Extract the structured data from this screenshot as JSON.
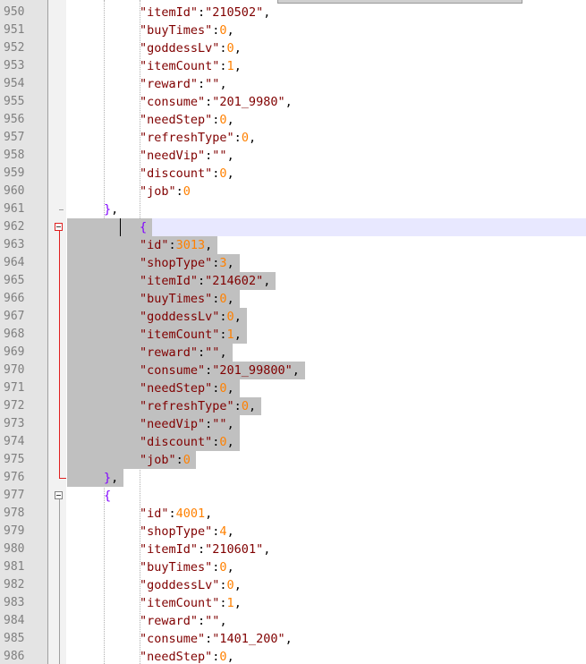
{
  "lines": [
    {
      "n": "950",
      "indent": 2,
      "t": [
        [
          "k",
          "\"itemId\""
        ],
        [
          "p",
          ":"
        ],
        [
          "s",
          "\"210502\""
        ],
        [
          "p",
          ","
        ]
      ]
    },
    {
      "n": "951",
      "indent": 2,
      "t": [
        [
          "k",
          "\"buyTimes\""
        ],
        [
          "p",
          ":"
        ],
        [
          "n",
          "0"
        ],
        [
          "p",
          ","
        ]
      ]
    },
    {
      "n": "952",
      "indent": 2,
      "t": [
        [
          "k",
          "\"goddessLv\""
        ],
        [
          "p",
          ":"
        ],
        [
          "n",
          "0"
        ],
        [
          "p",
          ","
        ]
      ]
    },
    {
      "n": "953",
      "indent": 2,
      "t": [
        [
          "k",
          "\"itemCount\""
        ],
        [
          "p",
          ":"
        ],
        [
          "n",
          "1"
        ],
        [
          "p",
          ","
        ]
      ]
    },
    {
      "n": "954",
      "indent": 2,
      "t": [
        [
          "k",
          "\"reward\""
        ],
        [
          "p",
          ":"
        ],
        [
          "s",
          "\"\""
        ],
        [
          "p",
          ","
        ]
      ]
    },
    {
      "n": "955",
      "indent": 2,
      "t": [
        [
          "k",
          "\"consume\""
        ],
        [
          "p",
          ":"
        ],
        [
          "s",
          "\"201_9980\""
        ],
        [
          "p",
          ","
        ]
      ]
    },
    {
      "n": "956",
      "indent": 2,
      "t": [
        [
          "k",
          "\"needStep\""
        ],
        [
          "p",
          ":"
        ],
        [
          "n",
          "0"
        ],
        [
          "p",
          ","
        ]
      ]
    },
    {
      "n": "957",
      "indent": 2,
      "t": [
        [
          "k",
          "\"refreshType\""
        ],
        [
          "p",
          ":"
        ],
        [
          "n",
          "0"
        ],
        [
          "p",
          ","
        ]
      ]
    },
    {
      "n": "958",
      "indent": 2,
      "t": [
        [
          "k",
          "\"needVip\""
        ],
        [
          "p",
          ":"
        ],
        [
          "s",
          "\"\""
        ],
        [
          "p",
          ","
        ]
      ]
    },
    {
      "n": "959",
      "indent": 2,
      "t": [
        [
          "k",
          "\"discount\""
        ],
        [
          "p",
          ":"
        ],
        [
          "n",
          "0"
        ],
        [
          "p",
          ","
        ]
      ]
    },
    {
      "n": "960",
      "indent": 2,
      "t": [
        [
          "k",
          "\"job\""
        ],
        [
          "p",
          ":"
        ],
        [
          "n",
          "0"
        ]
      ]
    },
    {
      "n": "961",
      "indent": 1,
      "t": [
        [
          "b",
          "}"
        ],
        [
          "p",
          ","
        ]
      ]
    },
    {
      "n": "962",
      "indent": 2,
      "t": [
        [
          "b",
          "{"
        ]
      ],
      "current": true,
      "sel": true
    },
    {
      "n": "963",
      "indent": 2,
      "t": [
        [
          "k",
          "\"id\""
        ],
        [
          "p",
          ":"
        ],
        [
          "n",
          "3013"
        ],
        [
          "p",
          ","
        ]
      ],
      "sel": true
    },
    {
      "n": "964",
      "indent": 2,
      "t": [
        [
          "k",
          "\"shopType\""
        ],
        [
          "p",
          ":"
        ],
        [
          "n",
          "3"
        ],
        [
          "p",
          ","
        ]
      ],
      "sel": true
    },
    {
      "n": "965",
      "indent": 2,
      "t": [
        [
          "k",
          "\"itemId\""
        ],
        [
          "p",
          ":"
        ],
        [
          "s",
          "\"214602\""
        ],
        [
          "p",
          ","
        ]
      ],
      "sel": true
    },
    {
      "n": "966",
      "indent": 2,
      "t": [
        [
          "k",
          "\"buyTimes\""
        ],
        [
          "p",
          ":"
        ],
        [
          "n",
          "0"
        ],
        [
          "p",
          ","
        ]
      ],
      "sel": true
    },
    {
      "n": "967",
      "indent": 2,
      "t": [
        [
          "k",
          "\"goddessLv\""
        ],
        [
          "p",
          ":"
        ],
        [
          "n",
          "0"
        ],
        [
          "p",
          ","
        ]
      ],
      "sel": true
    },
    {
      "n": "968",
      "indent": 2,
      "t": [
        [
          "k",
          "\"itemCount\""
        ],
        [
          "p",
          ":"
        ],
        [
          "n",
          "1"
        ],
        [
          "p",
          ","
        ]
      ],
      "sel": true
    },
    {
      "n": "969",
      "indent": 2,
      "t": [
        [
          "k",
          "\"reward\""
        ],
        [
          "p",
          ":"
        ],
        [
          "s",
          "\"\""
        ],
        [
          "p",
          ","
        ]
      ],
      "sel": true
    },
    {
      "n": "970",
      "indent": 2,
      "t": [
        [
          "k",
          "\"consume\""
        ],
        [
          "p",
          ":"
        ],
        [
          "s",
          "\"201_99800\""
        ],
        [
          "p",
          ","
        ]
      ],
      "sel": true
    },
    {
      "n": "971",
      "indent": 2,
      "t": [
        [
          "k",
          "\"needStep\""
        ],
        [
          "p",
          ":"
        ],
        [
          "n",
          "0"
        ],
        [
          "p",
          ","
        ]
      ],
      "sel": true
    },
    {
      "n": "972",
      "indent": 2,
      "t": [
        [
          "k",
          "\"refreshType\""
        ],
        [
          "p",
          ":"
        ],
        [
          "n",
          "0"
        ],
        [
          "p",
          ","
        ]
      ],
      "sel": true
    },
    {
      "n": "973",
      "indent": 2,
      "t": [
        [
          "k",
          "\"needVip\""
        ],
        [
          "p",
          ":"
        ],
        [
          "s",
          "\"\""
        ],
        [
          "p",
          ","
        ]
      ],
      "sel": true
    },
    {
      "n": "974",
      "indent": 2,
      "t": [
        [
          "k",
          "\"discount\""
        ],
        [
          "p",
          ":"
        ],
        [
          "n",
          "0"
        ],
        [
          "p",
          ","
        ]
      ],
      "sel": true
    },
    {
      "n": "975",
      "indent": 2,
      "t": [
        [
          "k",
          "\"job\""
        ],
        [
          "p",
          ":"
        ],
        [
          "n",
          "0"
        ]
      ],
      "sel": true
    },
    {
      "n": "976",
      "indent": 1,
      "t": [
        [
          "b",
          "}"
        ],
        [
          "p",
          ","
        ]
      ],
      "sel": true
    },
    {
      "n": "977",
      "indent": 1,
      "t": [
        [
          "b",
          "{"
        ]
      ]
    },
    {
      "n": "978",
      "indent": 2,
      "t": [
        [
          "k",
          "\"id\""
        ],
        [
          "p",
          ":"
        ],
        [
          "n",
          "4001"
        ],
        [
          "p",
          ","
        ]
      ]
    },
    {
      "n": "979",
      "indent": 2,
      "t": [
        [
          "k",
          "\"shopType\""
        ],
        [
          "p",
          ":"
        ],
        [
          "n",
          "4"
        ],
        [
          "p",
          ","
        ]
      ]
    },
    {
      "n": "980",
      "indent": 2,
      "t": [
        [
          "k",
          "\"itemId\""
        ],
        [
          "p",
          ":"
        ],
        [
          "s",
          "\"210601\""
        ],
        [
          "p",
          ","
        ]
      ]
    },
    {
      "n": "981",
      "indent": 2,
      "t": [
        [
          "k",
          "\"buyTimes\""
        ],
        [
          "p",
          ":"
        ],
        [
          "n",
          "0"
        ],
        [
          "p",
          ","
        ]
      ]
    },
    {
      "n": "982",
      "indent": 2,
      "t": [
        [
          "k",
          "\"goddessLv\""
        ],
        [
          "p",
          ":"
        ],
        [
          "n",
          "0"
        ],
        [
          "p",
          ","
        ]
      ]
    },
    {
      "n": "983",
      "indent": 2,
      "t": [
        [
          "k",
          "\"itemCount\""
        ],
        [
          "p",
          ":"
        ],
        [
          "n",
          "1"
        ],
        [
          "p",
          ","
        ]
      ]
    },
    {
      "n": "984",
      "indent": 2,
      "t": [
        [
          "k",
          "\"reward\""
        ],
        [
          "p",
          ":"
        ],
        [
          "s",
          "\"\""
        ],
        [
          "p",
          ","
        ]
      ]
    },
    {
      "n": "985",
      "indent": 2,
      "t": [
        [
          "k",
          "\"consume\""
        ],
        [
          "p",
          ":"
        ],
        [
          "s",
          "\"1401_200\""
        ],
        [
          "p",
          ","
        ]
      ]
    },
    {
      "n": "986",
      "indent": 2,
      "t": [
        [
          "k",
          "\"needStep\""
        ],
        [
          "p",
          ":"
        ],
        [
          "n",
          "0"
        ],
        [
          "p",
          ","
        ]
      ]
    }
  ]
}
